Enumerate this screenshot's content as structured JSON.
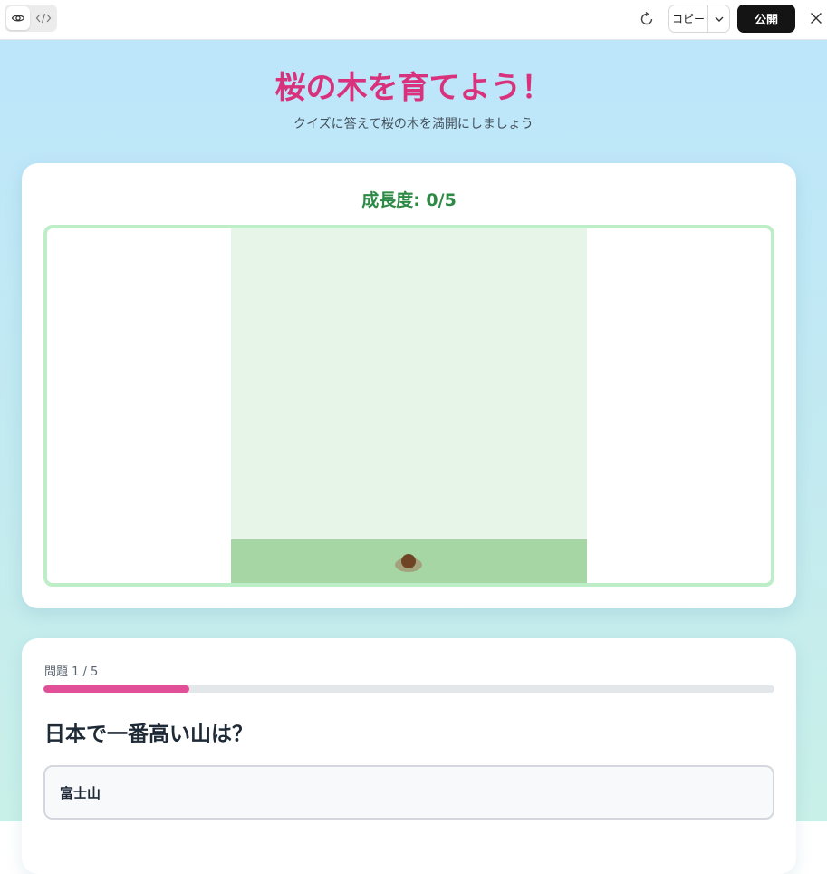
{
  "toolbar": {
    "copy_label": "コピー",
    "publish_label": "公開",
    "icons": [
      "eye-icon",
      "code-icon",
      "refresh-icon",
      "chevron-down-icon",
      "close-icon"
    ]
  },
  "app": {
    "title": "桜の木を育てよう！",
    "subtitle": "クイズに答えて桜の木を満開にしましょう",
    "growth_text": "成長度: 0/5",
    "growth_level": 0,
    "growth_max": 5
  },
  "quiz": {
    "counter": "問題 1 / 5",
    "progress_fraction": 0.2,
    "question": "日本で一番高い山は？",
    "options": [
      "富士山"
    ]
  },
  "colors": {
    "title": "#d9327c",
    "growth": "#2d8a45",
    "progress": "#e24f99",
    "publish_bg": "#141414"
  }
}
